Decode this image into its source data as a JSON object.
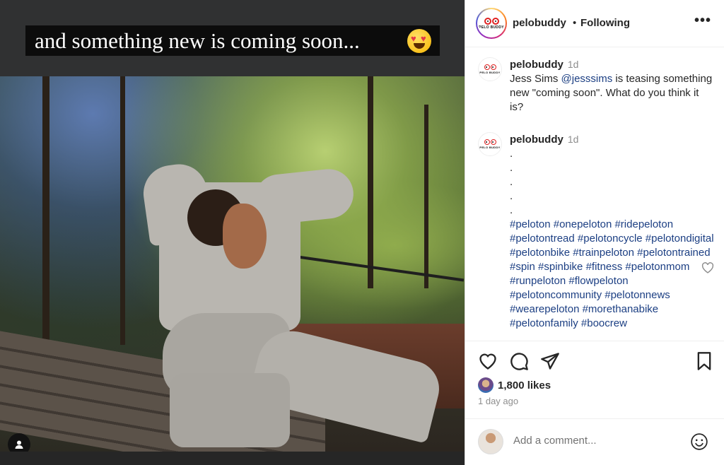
{
  "media": {
    "caption_overlay": "and something new is coming soon...",
    "caption_emoji": "heart-eyes-emoji"
  },
  "post": {
    "author": "pelobuddy",
    "separator": "•",
    "follow_status": "Following",
    "more_icon": "more-options-icon"
  },
  "comments": [
    {
      "user": "pelobuddy",
      "time": "1d",
      "text_pre": "Jess Sims ",
      "mention": "@jesssims",
      "text_post": " is teasing something new \"coming soon\". What do you think it is?"
    },
    {
      "user": "pelobuddy",
      "time": "1d",
      "dots": [
        ".",
        ".",
        ".",
        ".",
        "."
      ],
      "hashtags": "#peloton #onepeloton #ridepeloton #pelotontread #pelotoncycle #pelotondigital #pelotonbike #trainpeloton #pelotontrained #spin #spinbike #fitness #pelotonmom #runpeloton #flowpeloton #pelotoncommunity #pelotonnews #wearepeloton #morethanabike #pelotonfamily #boocrew"
    }
  ],
  "actions": {
    "likes": "1,800 likes",
    "time_ago": "1 day ago"
  },
  "comment_box": {
    "placeholder": "Add a comment..."
  },
  "logo_text": "PELO BUDDY",
  "colors": {
    "link": "#1c3f83",
    "muted": "#8e8e8e"
  }
}
